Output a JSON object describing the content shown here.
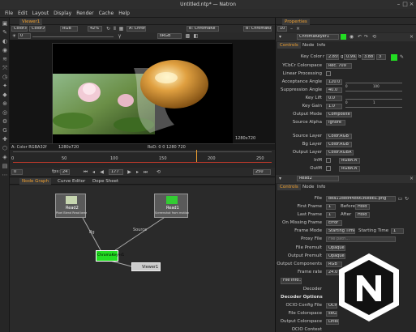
{
  "window": {
    "title": "Untitled.ntp* — Natron"
  },
  "menu": [
    "File",
    "Edit",
    "Layout",
    "Display",
    "Render",
    "Cache",
    "Help"
  ],
  "viewer": {
    "tab": "Viewer1",
    "layer": "Color.RGB",
    "alpha": "Color.A",
    "channels": "RGB",
    "zoom": "42%",
    "a_input": "A: ChromaKe",
    "b_input": "B: ChromaKe",
    "colorspace": "sRGB",
    "frame_res_right": "1280x720",
    "info_left": "A: Color RGBA32f",
    "info_res": "1280x720",
    "info_rod": "RoD: 0 0 1280 720",
    "fps_label": "fps:",
    "fps_value": "24",
    "timeline_ticks": [
      "0",
      "50",
      "100",
      "150",
      "200",
      "250"
    ],
    "timeline_marks_left": "1",
    "timeline_marks_right": "250",
    "current_frame": "177",
    "frame_start": "0",
    "frame_end": "250",
    "timeline_progress": 0.708
  },
  "bottom_tabs": [
    "Node Graph",
    "Curve Editor",
    "Dope Sheet"
  ],
  "nodes": {
    "read2_label": "Read2",
    "read2_sub": "Pixel Blend Read bear Glass hanc pond.dsf.png",
    "read1_label": "Read1",
    "read1_sub": "Screenshot from motion-green.png",
    "chroma_label": "ChromaKeyer1",
    "viewer_label": "Viewer1",
    "edge_bg": "Bg",
    "edge_source": "Source"
  },
  "properties": {
    "tab": "Properties",
    "max_count": "10",
    "chroma": {
      "name": "ChromaKeyer1",
      "subtabs": [
        "Controls",
        "Node",
        "Info"
      ],
      "key_color_label": "Key Color",
      "key_r_label": "r",
      "key_r": "2.859",
      "key_g_label": "g",
      "key_g": "0.992",
      "key_b_label": "b",
      "key_b": "3.887",
      "key_a": "3",
      "ycbcr_label": "YCbCr Colorspace",
      "ycbcr_value": "Rec. 709",
      "linear_label": "Linear Processing",
      "accept_label": "Acceptance Angle",
      "accept_value": "120.0",
      "suppress_label": "Suppression Angle",
      "suppress_value": "40.0",
      "keylift_label": "Key Lift",
      "keylift_value": "0.0",
      "keygain_label": "Key Gain",
      "keygain_value": "1.0",
      "output_mode_label": "Output Mode",
      "output_mode_value": "Composite",
      "source_alpha_label": "Source Alpha",
      "source_alpha_value": "Ignore",
      "source_layer_label": "Source Layer",
      "source_layer_value": "Color.RGB",
      "bg_layer_label": "Bg Layer",
      "bg_layer_value": "Color.RGB",
      "output_layer_label": "Output Layer",
      "output_layer_value": "Color.RGBA",
      "inm_label": "InM",
      "inm_value": "RGBA.A",
      "outm_label": "OutM",
      "outm_value": "RGBA.A",
      "slider_ticks_a": [
        "0",
        "100"
      ],
      "slider_ticks_b": [
        "0",
        "1"
      ]
    },
    "read": {
      "name": "Read2",
      "subtabs": [
        "Controls",
        "Node",
        "Info"
      ],
      "file_label": "File",
      "file_value": "bea11d8d4486636ebb1.png",
      "first_frame_label": "First Frame",
      "first_frame_value": "1",
      "before_label": "Before",
      "before_value": "Hold",
      "last_frame_label": "Last Frame",
      "last_frame_value": "1",
      "after_label": "After",
      "after_value": "Hold",
      "missing_label": "On Missing Frame",
      "missing_value": "Error",
      "frame_mode_label": "Frame Mode",
      "frame_mode_value": "Starting Time",
      "starting_time_label": "Starting Time",
      "starting_time_value": "1",
      "proxy_label": "Proxy File",
      "proxy_placeholder": "File path...",
      "file_premult_label": "File Premult",
      "file_premult_value": "Opaque",
      "output_premult_label": "Output Premult",
      "output_premult_value": "Opaque",
      "output_components_label": "Output Components",
      "output_components_value": "RGB",
      "frame_rate_label": "Frame rate",
      "frame_rate_value": "24.0",
      "file_info_button": "File Info...",
      "decoder_label": "Decoder",
      "decoder_options_label": "Decoder Options",
      "ocio_config_label": "OCIO Config File",
      "ocio_config_value": "OCIO",
      "file_colorspace_label": "File Colorspace",
      "file_colorspace_value": "sRGB",
      "output_colorspace_label": "Output Colorspace",
      "output_colorspace_value": "Linear",
      "ocio_context_label": "OCIO Context"
    }
  },
  "colors": {
    "accent": "#f0a030",
    "node_green": "#22dd22",
    "panel_bg": "#232323",
    "timeline_red": "#c0392b"
  },
  "logo_letter": "N"
}
